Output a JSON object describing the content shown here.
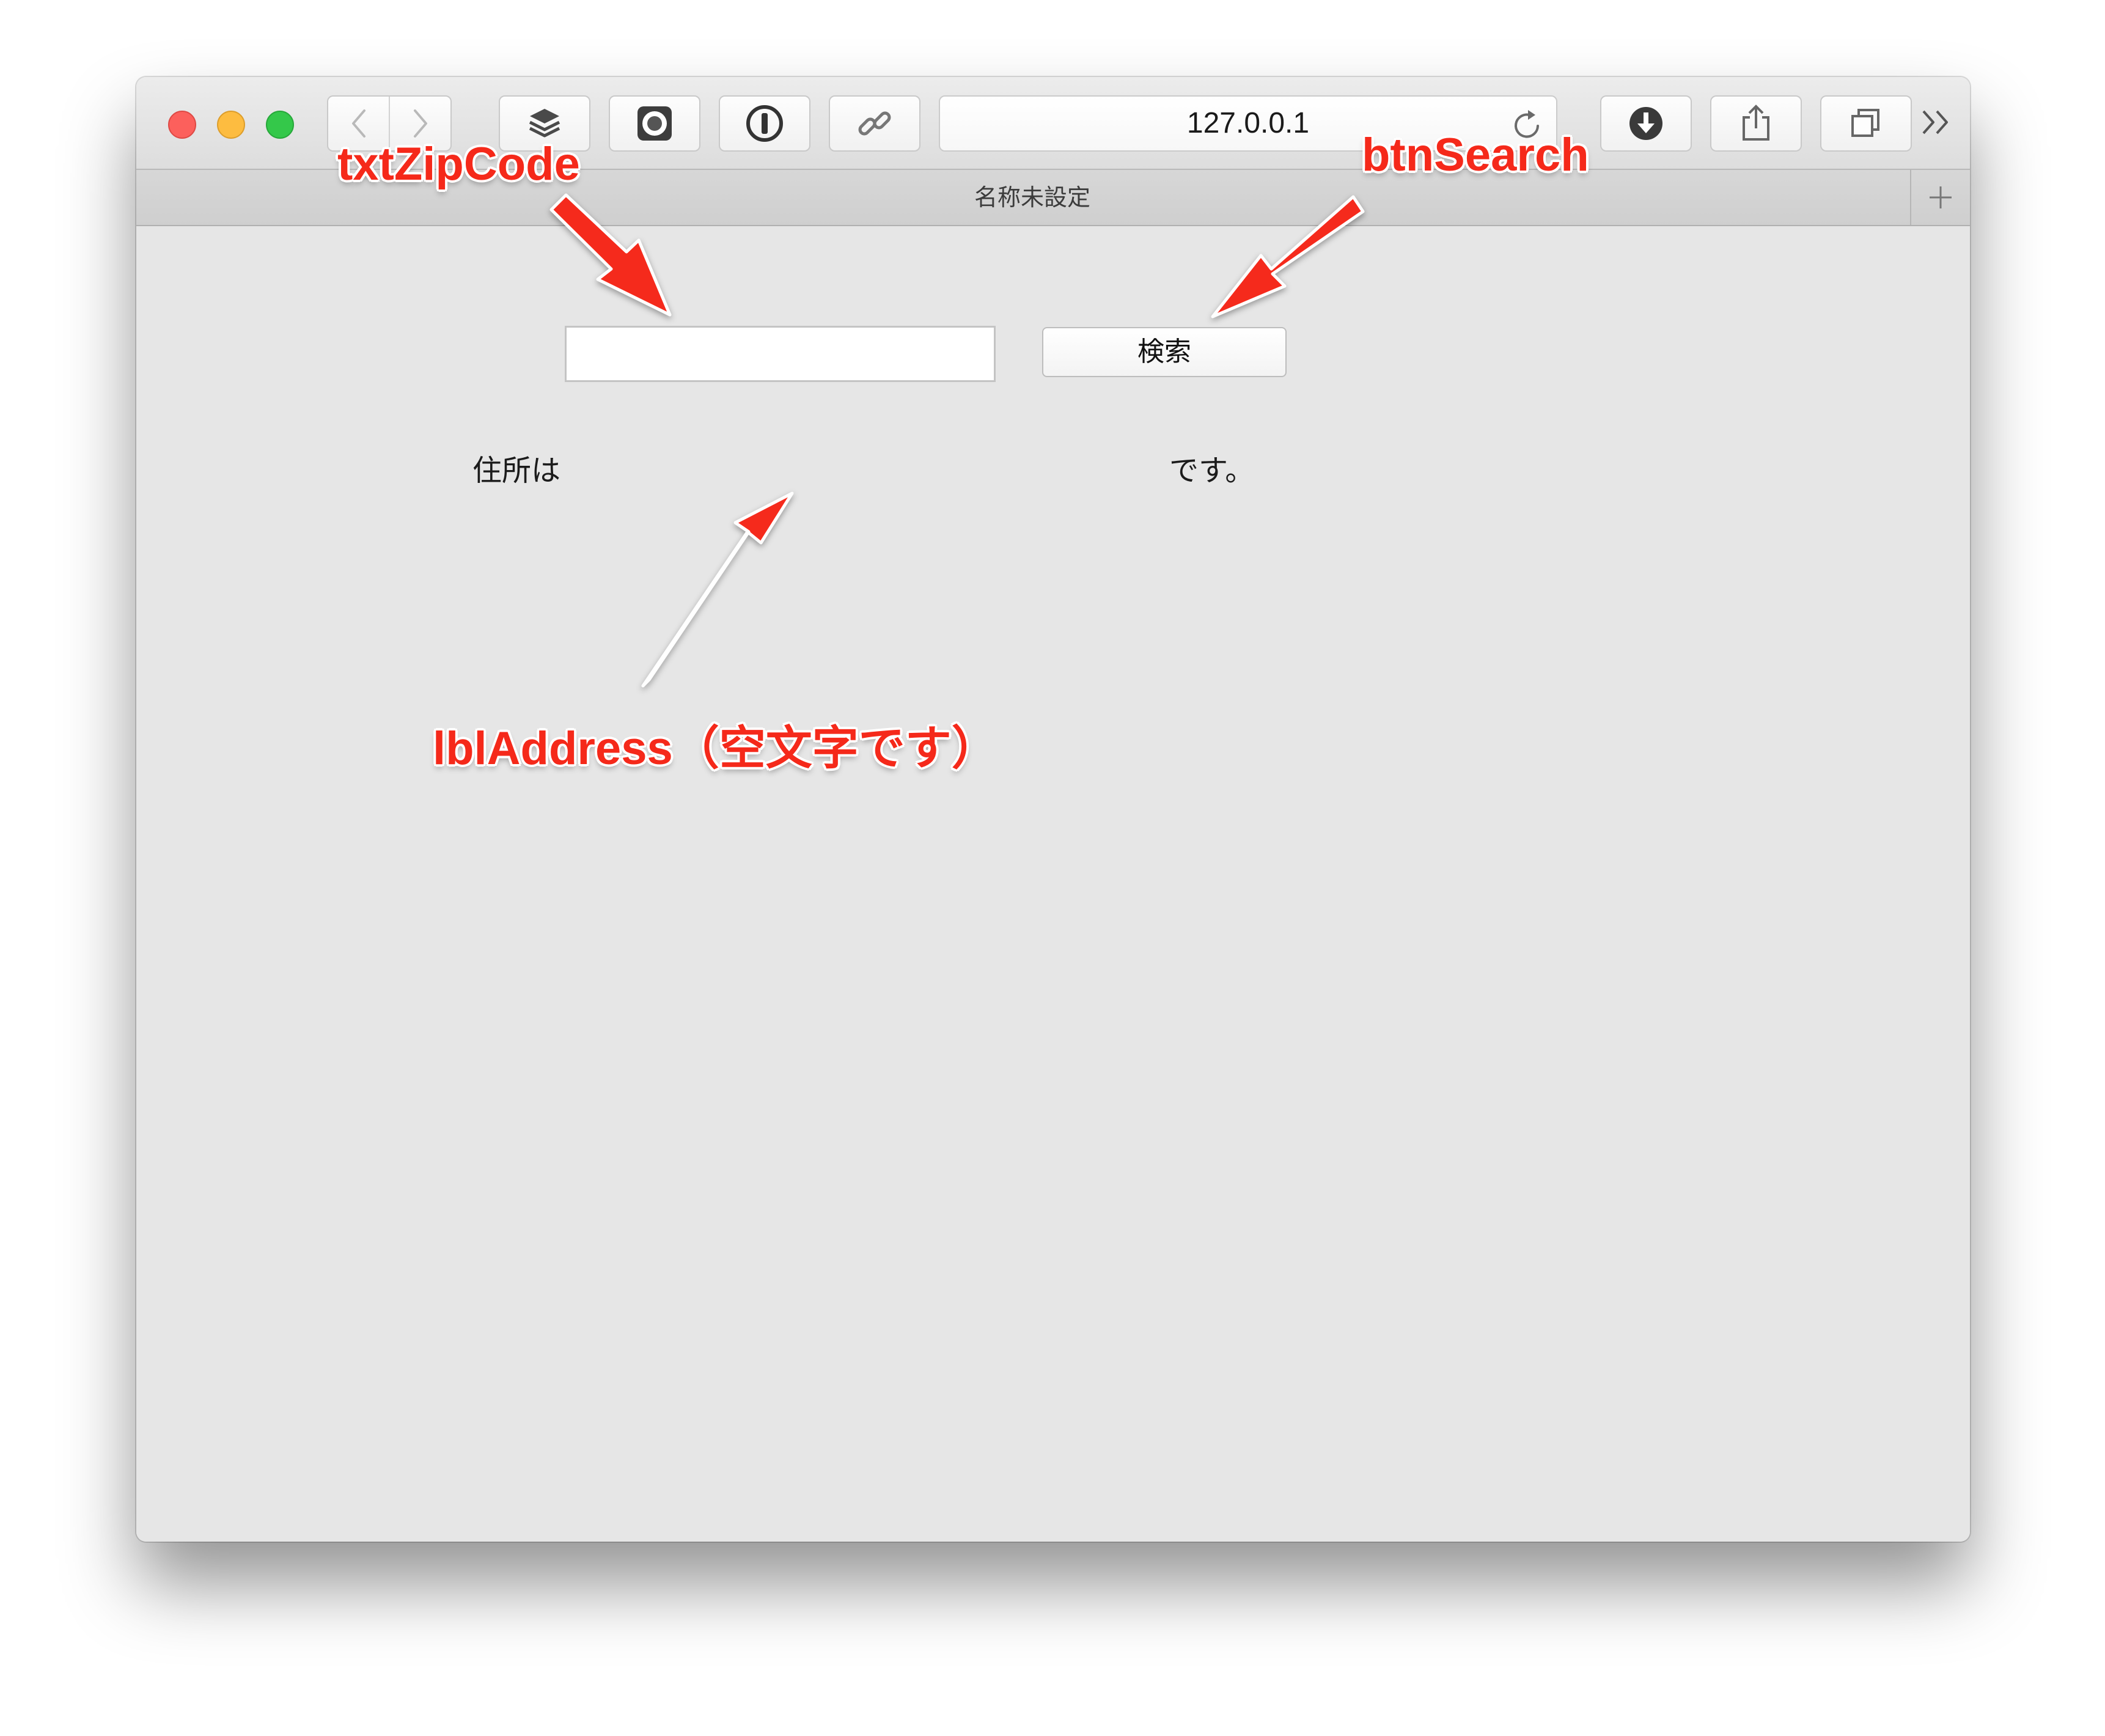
{
  "browser": {
    "address_url": "127.0.0.1",
    "tab_title": "名称未設定"
  },
  "toolbar_icons": [
    "back-icon",
    "forward-icon",
    "layers-icon",
    "record-icon",
    "info-icon",
    "link-icon",
    "reload-icon",
    "download-icon",
    "share-icon",
    "tabs-overview-icon",
    "more-chevrons-icon",
    "plus-icon"
  ],
  "page": {
    "zip_input_value": "",
    "search_button_label": "検索",
    "address_prefix": "住所は",
    "address_value": "",
    "address_suffix": "です。"
  },
  "annotations": {
    "zip_label": "txtZipCode",
    "search_label": "btnSearch",
    "address_label": "lblAddress（空文字です）",
    "color": "#f5291a"
  }
}
